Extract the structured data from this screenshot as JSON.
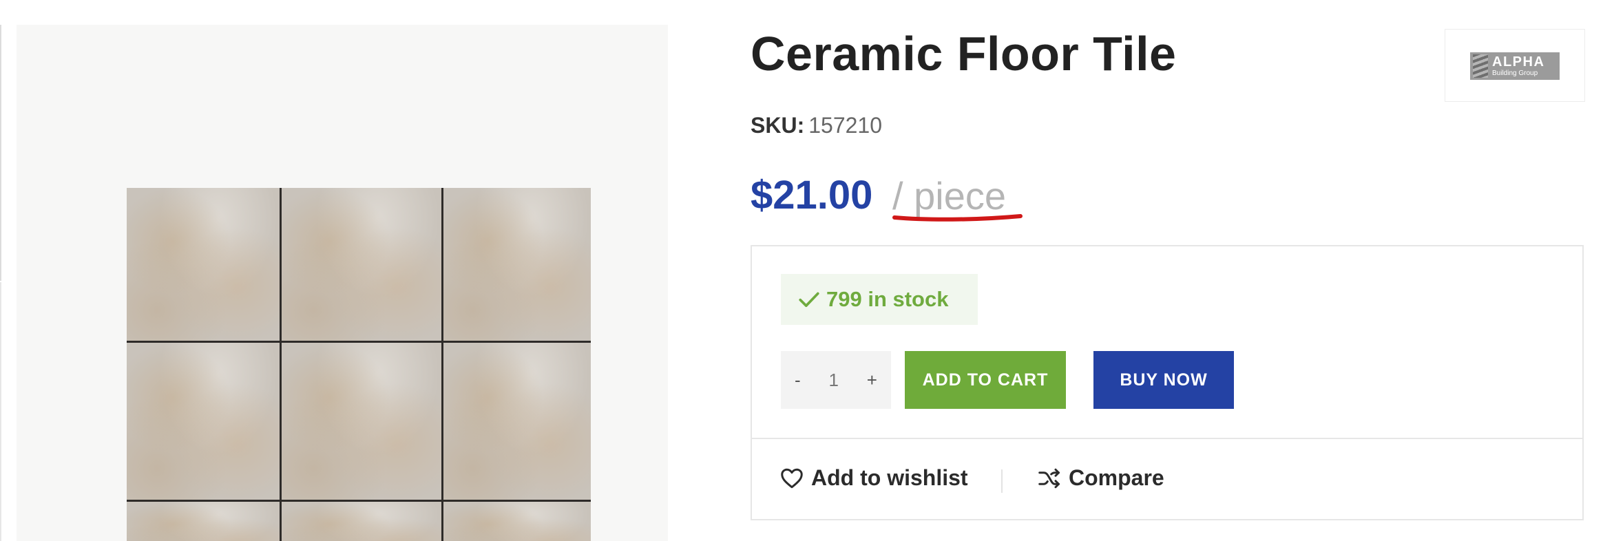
{
  "product": {
    "title": "Ceramic Floor Tile",
    "sku_label": "SKU:",
    "sku_value": "157210",
    "price": "$21.00",
    "unit": "/ piece",
    "image_name": "ceramic-floor-tile-image"
  },
  "brand": {
    "name": "ALPHA",
    "tagline": "Building Group"
  },
  "stock": {
    "text": "799 in stock",
    "icon": "check-icon",
    "color": "#6fab3e"
  },
  "quantity": {
    "minus": "-",
    "value": "1",
    "plus": "+"
  },
  "buttons": {
    "add_to_cart": "ADD TO CART",
    "buy_now": "BUY NOW"
  },
  "actions": {
    "wishlist": "Add to wishlist",
    "wishlist_icon": "heart-icon",
    "compare": "Compare",
    "compare_icon": "shuffle-icon"
  },
  "colors": {
    "price": "#2442a4",
    "add_to_cart": "#6fab3a",
    "buy_now": "#2442a4",
    "annotation_underline": "#d01818"
  }
}
